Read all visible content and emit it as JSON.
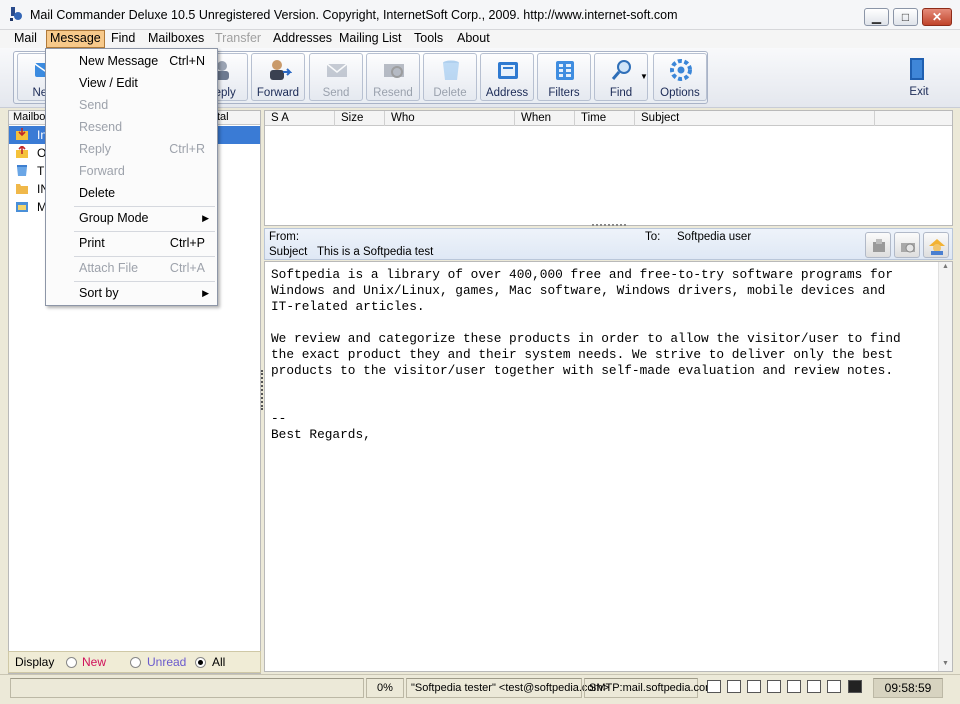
{
  "window": {
    "title": "Mail Commander Deluxe 10.5 Unregistered Version. Copyright, InternetSoft Corp., 2009. http://www.internet-soft.com",
    "minimize": "▁",
    "maximize": "□",
    "close": "✕"
  },
  "menubar": {
    "items": [
      {
        "label": "Mail"
      },
      {
        "label": "Message"
      },
      {
        "label": "Find"
      },
      {
        "label": "Mailboxes"
      },
      {
        "label": "Transfer"
      },
      {
        "label": "Addresses"
      },
      {
        "label": "Mailing List"
      },
      {
        "label": "Tools"
      },
      {
        "label": "About"
      }
    ]
  },
  "toolbar": {
    "buttons": [
      {
        "label": "New",
        "icon": "new-message-icon"
      },
      {
        "label": "Reply",
        "icon": "reply-icon"
      },
      {
        "label": "Forward",
        "icon": "forward-icon"
      },
      {
        "label": "Send",
        "icon": "send-icon"
      },
      {
        "label": "Resend",
        "icon": "resend-icon"
      },
      {
        "label": "Delete",
        "icon": "trash-icon"
      },
      {
        "label": "Address",
        "icon": "address-book-icon"
      },
      {
        "label": "Filters",
        "icon": "filter-icon"
      },
      {
        "label": "Find",
        "icon": "magnifier-icon"
      },
      {
        "label": "Options",
        "icon": "gear-icon"
      }
    ],
    "exit_label": "Exit"
  },
  "message_menu": {
    "items": [
      {
        "label": "New Message",
        "shortcut": "Ctrl+N",
        "enabled": true
      },
      {
        "label": "View / Edit",
        "shortcut": "",
        "enabled": true
      },
      {
        "label": "Send",
        "shortcut": "",
        "enabled": false
      },
      {
        "label": "Resend",
        "shortcut": "",
        "enabled": false
      },
      {
        "label": "Reply",
        "shortcut": "Ctrl+R",
        "enabled": false
      },
      {
        "label": "Forward",
        "shortcut": "",
        "enabled": false
      },
      {
        "label": "Delete",
        "shortcut": "",
        "enabled": true
      },
      {
        "label": "Group Mode",
        "shortcut": "",
        "enabled": true,
        "submenu": true
      },
      {
        "label": "Print",
        "shortcut": "Ctrl+P",
        "enabled": true
      },
      {
        "label": "Attach File",
        "shortcut": "Ctrl+A",
        "enabled": false
      },
      {
        "label": "Sort by",
        "shortcut": "",
        "enabled": true,
        "submenu": true
      }
    ]
  },
  "mailboxes": {
    "header_left": "Mailbo",
    "header_right": "tal",
    "items": [
      {
        "label": "In",
        "icon": "inbox-icon",
        "selected": true
      },
      {
        "label": "O",
        "icon": "outbox-icon",
        "selected": false
      },
      {
        "label": "T",
        "icon": "trash-icon",
        "selected": false
      },
      {
        "label": "IN",
        "icon": "folder-icon",
        "selected": false
      },
      {
        "label": "M",
        "icon": "mail-folder-icon",
        "selected": false
      }
    ]
  },
  "display_filter": {
    "label": "Display",
    "options": [
      {
        "label": "New",
        "color": "#d0105a",
        "checked": false
      },
      {
        "label": "Unread",
        "color": "#6a5acd",
        "checked": false
      },
      {
        "label": "All",
        "color": "#000000",
        "checked": true
      }
    ]
  },
  "message_list": {
    "columns": [
      "S A",
      "Size",
      "Who",
      "When",
      "Time",
      "Subject"
    ]
  },
  "preview": {
    "from_label": "From:",
    "from_value": "",
    "to_label": "To:",
    "to_value": "Softpedia user",
    "subject_label": "Subject",
    "subject_value": "This is a Softpedia test",
    "body": "Softpedia is a library of over 400,000 free and free-to-try software programs for\nWindows and Unix/Linux, games, Mac software, Windows drivers, mobile devices and\nIT-related articles.\n\nWe review and categorize these products in order to allow the visitor/user to find\nthe exact product they and their system needs. We strive to deliver only the best\nproducts to the visitor/user together with self-made evaluation and review notes.\n\n\n--\nBest Regards,"
  },
  "statusbar": {
    "progress": "0%",
    "sender": "\"Softpedia tester\" <test@softpedia.com>",
    "smtp": "SMTP:mail.softpedia.com",
    "clock": "09:58:59"
  },
  "colors": {
    "selection": "#3a7bd5",
    "menu_active": "#f7c98a",
    "toolbar_text": "#1b2a56"
  }
}
